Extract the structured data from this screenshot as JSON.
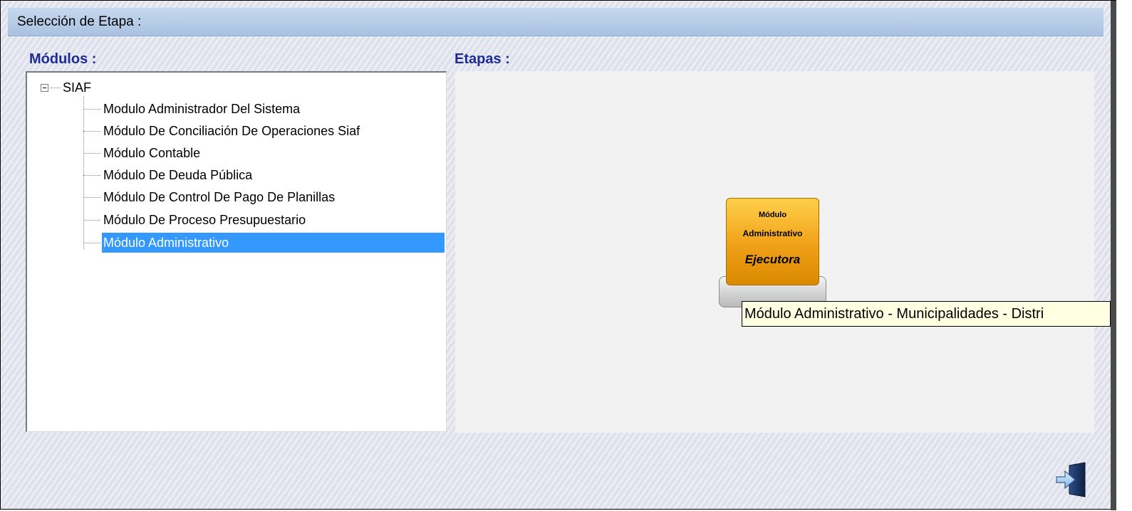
{
  "window": {
    "title": "Selección de Etapa :"
  },
  "modules": {
    "label": "Módulos :",
    "root": "SIAF",
    "items": [
      {
        "label": "Modulo Administrador Del Sistema",
        "selected": false
      },
      {
        "label": "Módulo De Conciliación De Operaciones Siaf",
        "selected": false
      },
      {
        "label": "Módulo Contable",
        "selected": false
      },
      {
        "label": "Módulo De Deuda Pública",
        "selected": false
      },
      {
        "label": "Módulo De Control De Pago De Planillas",
        "selected": false
      },
      {
        "label": "Módulo De Proceso Presupuestario",
        "selected": false
      },
      {
        "label": "Módulo Administrativo",
        "selected": true
      }
    ]
  },
  "stages": {
    "label": "Etapas :",
    "card": {
      "line1": "Módulo",
      "line2": "Administrativo",
      "line3": "Ejecutora"
    },
    "tooltip": "Módulo Administrativo - Municipalidades - Distri"
  },
  "toolbar": {
    "exit_icon": "exit-door-icon"
  },
  "colors": {
    "accent_label": "#1d2c96",
    "selection": "#3399ff",
    "card": "#f0a018",
    "tooltip_bg": "#ffffe1"
  }
}
